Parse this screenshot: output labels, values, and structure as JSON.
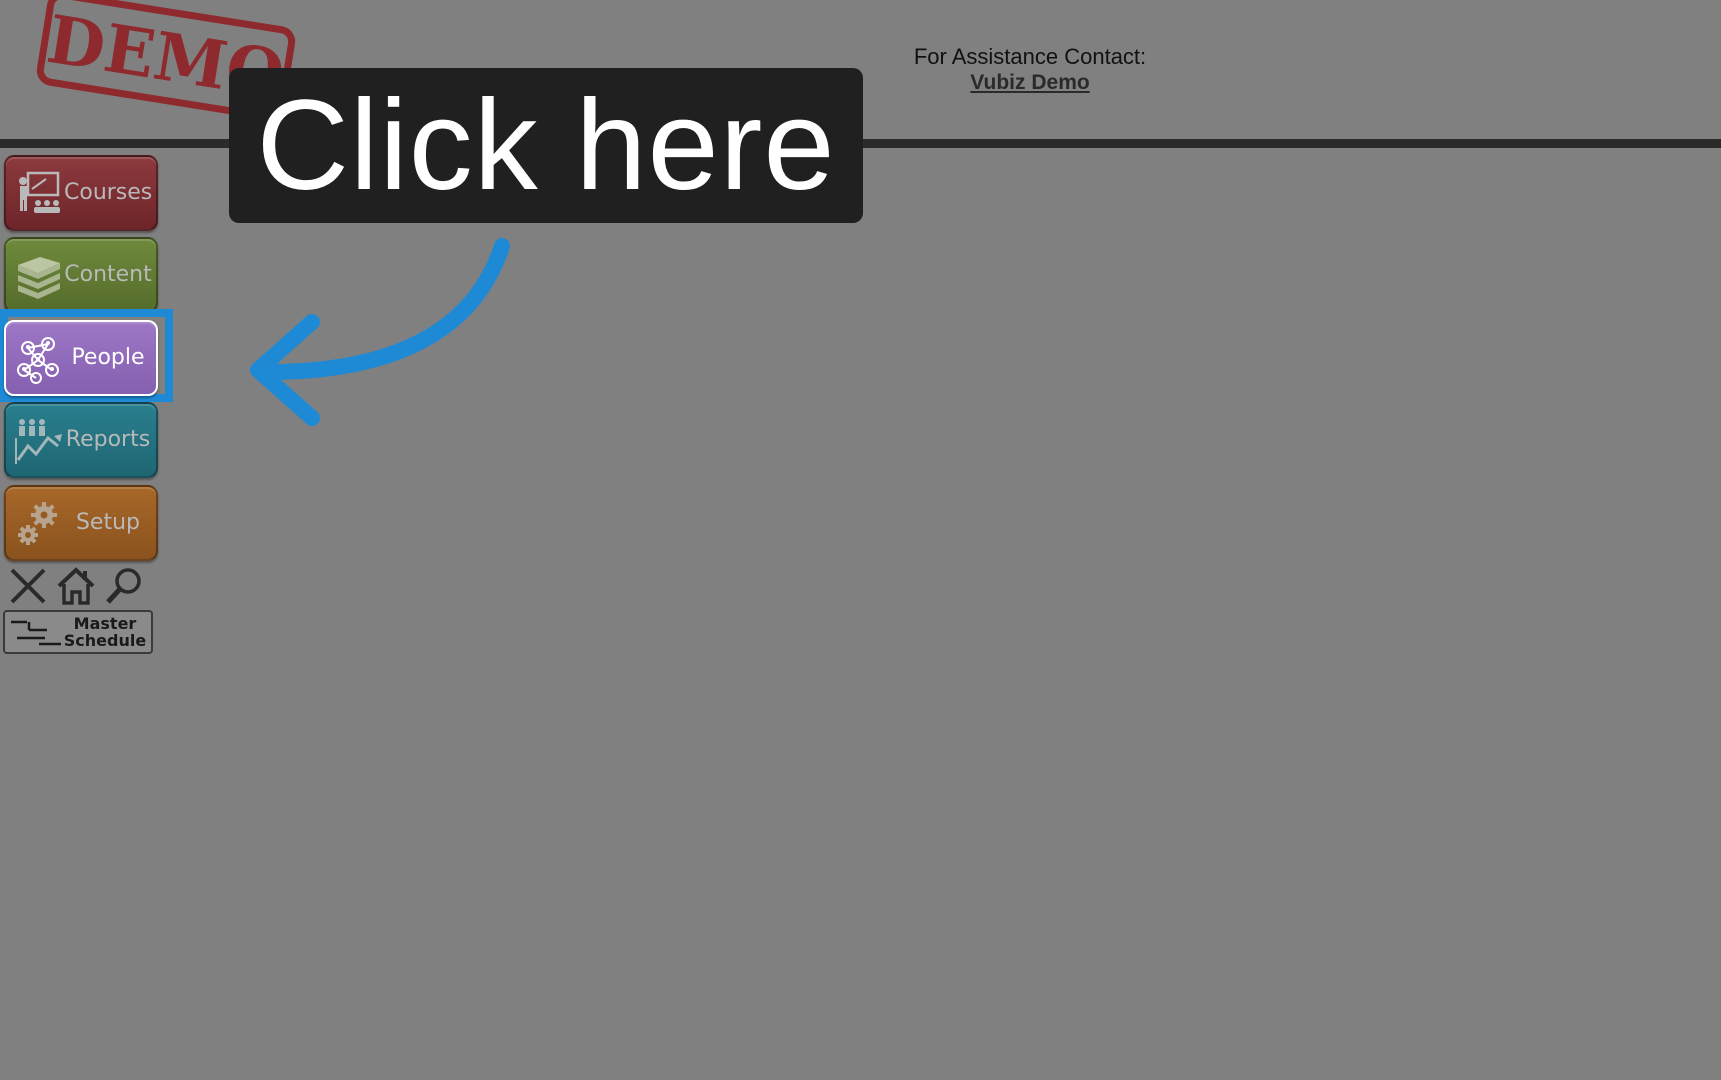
{
  "stamp": {
    "text": "DEMO"
  },
  "header": {
    "contact_label": "For Assistance Contact:",
    "contact_link": "Vubiz Demo"
  },
  "callout": {
    "text": "Click here"
  },
  "sidebar": {
    "items": [
      {
        "label": "Courses",
        "icon": "presenter-icon",
        "color": "#7a2e33"
      },
      {
        "label": "Content",
        "icon": "book-stack-icon",
        "color": "#627a33"
      },
      {
        "label": "People",
        "icon": "network-people-icon",
        "color": "#926bbd"
      },
      {
        "label": "Reports",
        "icon": "chart-people-icon",
        "color": "#257380"
      },
      {
        "label": "Setup",
        "icon": "gears-icon",
        "color": "#985d24"
      }
    ],
    "utilities": [
      {
        "icon": "close-icon"
      },
      {
        "icon": "home-icon"
      },
      {
        "icon": "search-icon"
      }
    ],
    "master_schedule": {
      "line1": "Master",
      "line2": "Schedule",
      "icon": "gantt-icon"
    }
  },
  "colors": {
    "background": "#808080",
    "highlight": "#1e8ad6",
    "callout_bg": "#202020"
  }
}
